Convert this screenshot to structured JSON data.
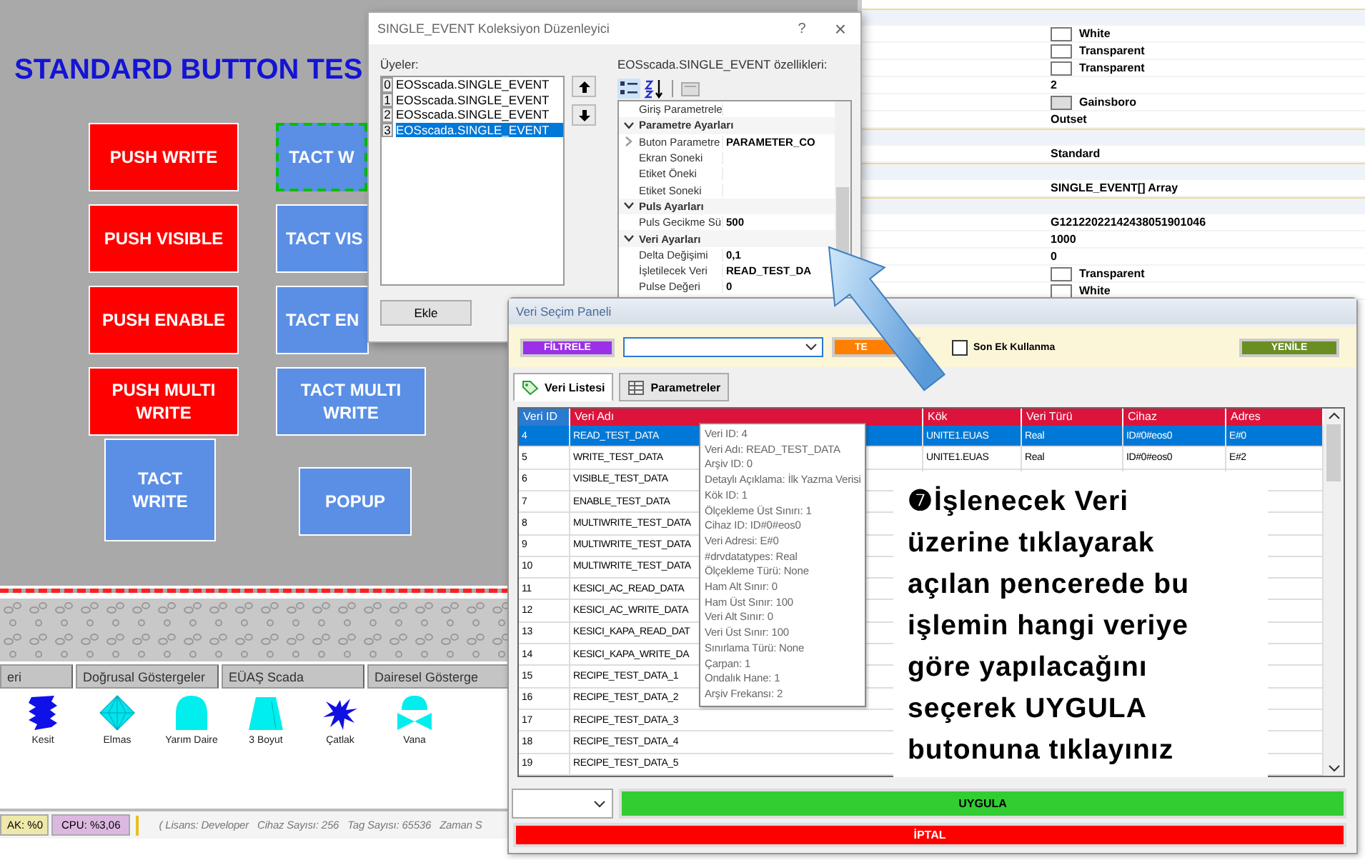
{
  "designer": {
    "title": "STANDARD BUTTON TES",
    "buttons": [
      {
        "label": "PUSH WRITE",
        "kind": "push",
        "selected": false
      },
      {
        "label": "TACT W",
        "kind": "tact",
        "selected": true
      },
      {
        "label": "PUSH VISIBLE",
        "kind": "push",
        "selected": false
      },
      {
        "label": "TACT VIS",
        "kind": "tact",
        "selected": false
      },
      {
        "label": "PUSH ENABLE",
        "kind": "push",
        "selected": false
      },
      {
        "label": "TACT EN",
        "kind": "tact",
        "selected": false
      },
      {
        "label": "PUSH MULTI WRITE",
        "kind": "push",
        "selected": false
      },
      {
        "label": "TACT MULTI WRITE",
        "kind": "tact",
        "selected": false
      }
    ],
    "lower_buttons": [
      {
        "label": "TACT WRITE",
        "kind": "tact",
        "selected": false
      },
      {
        "label": "POPUP",
        "kind": "tact",
        "selected": false
      }
    ],
    "toolbox_tabs": [
      "eri",
      "Doğrusal Göstergeler",
      "EÜAŞ Scada",
      "Dairesel Gösterge"
    ],
    "shapes": [
      {
        "label": "Kesit",
        "kind": "section"
      },
      {
        "label": "Elmas",
        "kind": "diamond"
      },
      {
        "label": "Yarım Daire",
        "kind": "dome"
      },
      {
        "label": "3 Boyut",
        "kind": "trapezoid"
      },
      {
        "label": "Çatlak",
        "kind": "crack"
      },
      {
        "label": "Vana",
        "kind": "valve"
      }
    ],
    "status_bar": {
      "memory": "AK: %0",
      "cpu": "CPU: %3,06",
      "info": [
        "( Lisans: Developer",
        "Cihaz Sayısı: 256",
        "Tag Sayısı: 65536",
        "Zaman S"
      ]
    }
  },
  "property_grid": {
    "rows": [
      {
        "kind": "category"
      },
      {
        "kind": "color",
        "color": "#ffffff",
        "value": "White"
      },
      {
        "kind": "color",
        "color": "#ffffff",
        "value": "Transparent"
      },
      {
        "kind": "color",
        "color": "#ffffff",
        "value": "Transparent"
      },
      {
        "kind": "text",
        "value": "2"
      },
      {
        "kind": "color",
        "color": "#dcdcdc",
        "value": "Gainsboro"
      },
      {
        "kind": "text",
        "value": "Outset"
      },
      {
        "kind": "category"
      },
      {
        "kind": "text",
        "value": "Standard"
      },
      {
        "kind": "category"
      },
      {
        "kind": "text",
        "value": "SINGLE_EVENT[] Array"
      },
      {
        "kind": "category"
      },
      {
        "kind": "text",
        "value": "G12122022142438051901046"
      },
      {
        "kind": "text",
        "value": "1000"
      },
      {
        "kind": "text",
        "value": "0"
      },
      {
        "kind": "color",
        "color": "#ffffff",
        "value": "Transparent"
      },
      {
        "kind": "color",
        "color": "#ffffff",
        "value": "White"
      }
    ]
  },
  "collection_editor": {
    "title": "SINGLE_EVENT Koleksiyon Düzenleyici",
    "help": "?",
    "close": "×",
    "members_label": "Üyeler:",
    "members": [
      {
        "index": "0",
        "name": "EOSscada.SINGLE_EVENT",
        "selected": false
      },
      {
        "index": "1",
        "name": "EOSscada.SINGLE_EVENT",
        "selected": false
      },
      {
        "index": "2",
        "name": "EOSscada.SINGLE_EVENT",
        "selected": false
      },
      {
        "index": "3",
        "name": "EOSscada.SINGLE_EVENT",
        "selected": true
      }
    ],
    "properties_label": "EOSscada.SINGLE_EVENT özellikleri:",
    "properties": [
      {
        "kind": "property",
        "name": "Giriş Parametrele"
      },
      {
        "kind": "category",
        "name": "Parametre Ayarları",
        "expanded": true
      },
      {
        "kind": "property",
        "name": "Buton Parametre",
        "value": "PARAMETER_CO",
        "expanded": false
      },
      {
        "kind": "property",
        "name": "Ekran Soneki"
      },
      {
        "kind": "property",
        "name": "Etiket Öneki"
      },
      {
        "kind": "property",
        "name": "Etiket Soneki"
      },
      {
        "kind": "category",
        "name": "Puls Ayarları",
        "expanded": true
      },
      {
        "kind": "property",
        "name": "Puls Gecikme Sü",
        "value": "500"
      },
      {
        "kind": "category",
        "name": "Veri Ayarları",
        "expanded": true
      },
      {
        "kind": "property",
        "name": "Delta Değişimi",
        "value": "0,1"
      },
      {
        "kind": "property",
        "name": "İşletilecek Veri",
        "value": "READ_TEST_DA"
      },
      {
        "kind": "property",
        "name": "Pulse Değeri",
        "value": "0"
      }
    ],
    "add_button": "Ekle"
  },
  "data_panel": {
    "title": "Veri Seçim Paneli",
    "filter_button": "FİLTRELE",
    "clear_button": "TE",
    "suffix_checkbox": {
      "label": "Son Ek Kullanma",
      "checked": false
    },
    "refresh_button": "YENİLE",
    "tabs": [
      {
        "label": "Veri Listesi",
        "kind": "tag",
        "selected": true
      },
      {
        "label": "Parametreler",
        "kind": "grid",
        "selected": false
      }
    ],
    "columns": [
      {
        "label": "Veri ID",
        "sorted": true
      },
      {
        "label": "Veri Adı",
        "sorted": false
      },
      {
        "label": "Kök",
        "sorted": false
      },
      {
        "label": "Veri Türü",
        "sorted": false
      },
      {
        "label": "Cihaz",
        "sorted": false
      },
      {
        "label": "Adres",
        "sorted": false
      }
    ],
    "rows": [
      {
        "cells": [
          "4",
          "READ_TEST_DATA",
          "UNITE1.EUAS",
          "Real",
          "ID#0#eos0",
          "E#0"
        ],
        "selected": true
      },
      {
        "cells": [
          "5",
          "WRITE_TEST_DATA",
          "UNITE1.EUAS",
          "Real",
          "ID#0#eos0",
          "E#2"
        ],
        "selected": false
      },
      {
        "cells": [
          "6",
          "VISIBLE_TEST_DATA"
        ],
        "selected": false
      },
      {
        "cells": [
          "7",
          "ENABLE_TEST_DATA"
        ],
        "selected": false
      },
      {
        "cells": [
          "8",
          "MULTIWRITE_TEST_DATA"
        ],
        "selected": false
      },
      {
        "cells": [
          "9",
          "MULTIWRITE_TEST_DATA"
        ],
        "selected": false
      },
      {
        "cells": [
          "10",
          "MULTIWRITE_TEST_DATA"
        ],
        "selected": false
      },
      {
        "cells": [
          "11",
          "KESICI_AC_READ_DATA"
        ],
        "selected": false
      },
      {
        "cells": [
          "12",
          "KESICI_AC_WRITE_DATA"
        ],
        "selected": false
      },
      {
        "cells": [
          "13",
          "KESICI_KAPA_READ_DAT"
        ],
        "selected": false
      },
      {
        "cells": [
          "14",
          "KESICI_KAPA_WRITE_DA"
        ],
        "selected": false
      },
      {
        "cells": [
          "15",
          "RECIPE_TEST_DATA_1"
        ],
        "selected": false
      },
      {
        "cells": [
          "16",
          "RECIPE_TEST_DATA_2"
        ],
        "selected": false
      },
      {
        "cells": [
          "17",
          "RECIPE_TEST_DATA_3"
        ],
        "selected": false
      },
      {
        "cells": [
          "18",
          "RECIPE_TEST_DATA_4"
        ],
        "selected": false
      },
      {
        "cells": [
          "19",
          "RECIPE_TEST_DATA_5"
        ],
        "selected": false
      }
    ],
    "tooltip": [
      "Veri ID: 4",
      "Veri Adı: READ_TEST_DATA",
      "Arşiv ID: 0",
      "Detaylı Açıklama: İlk Yazma Verisi",
      "Kök ID: 1",
      "Ölçekleme Üst Sınırı: 1",
      "Cihaz ID: ID#0#eos0",
      "Veri Adresi: E#0",
      "#drvdatatypes: Real",
      "Ölçekleme Türü: None",
      "Ham Alt Sınır: 0",
      "Ham Üst Sınır: 100",
      "Veri Alt Sınır: 0",
      "Veri Üst Sınır: 100",
      "Sınırlama Türü: None",
      "Çarpan: 1",
      "Ondalık Hane: 1",
      "Arşiv Frekansı: 2"
    ],
    "apply_button": "UYGULA",
    "cancel_button": "İPTAL"
  },
  "annotation": {
    "text": "❼İşlenecek Veri\nüzerine tıklayarak\naçılan pencerede bu\nişlemin hangi veriye\ngöre yapılacağını\nseçerek UYGULA\nbutonuna tıklayınız"
  }
}
